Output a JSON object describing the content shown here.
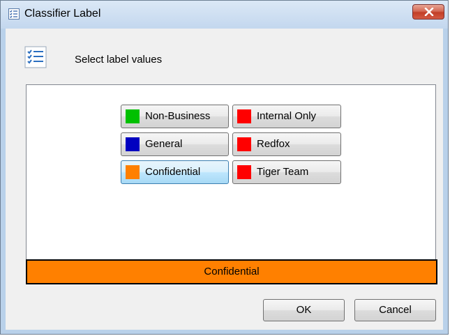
{
  "window": {
    "title": "Classifier Label",
    "icon": "list-check-icon",
    "close_icon": "close-icon"
  },
  "header": {
    "icon": "checklist-icon",
    "text": "Select label values"
  },
  "labels": [
    {
      "label": "Non-Business",
      "color": "#00c000",
      "selected": false
    },
    {
      "label": "Internal Only",
      "color": "#ff0000",
      "selected": false
    },
    {
      "label": "General",
      "color": "#0000c0",
      "selected": false
    },
    {
      "label": "Redfox",
      "color": "#ff0000",
      "selected": false
    },
    {
      "label": "Confidential",
      "color": "#ff8000",
      "selected": true
    },
    {
      "label": "Tiger Team",
      "color": "#ff0000",
      "selected": false
    }
  ],
  "status": {
    "text": "Confidential",
    "color": "#ff8000"
  },
  "buttons": {
    "ok_label": "OK",
    "cancel_label": "Cancel"
  }
}
